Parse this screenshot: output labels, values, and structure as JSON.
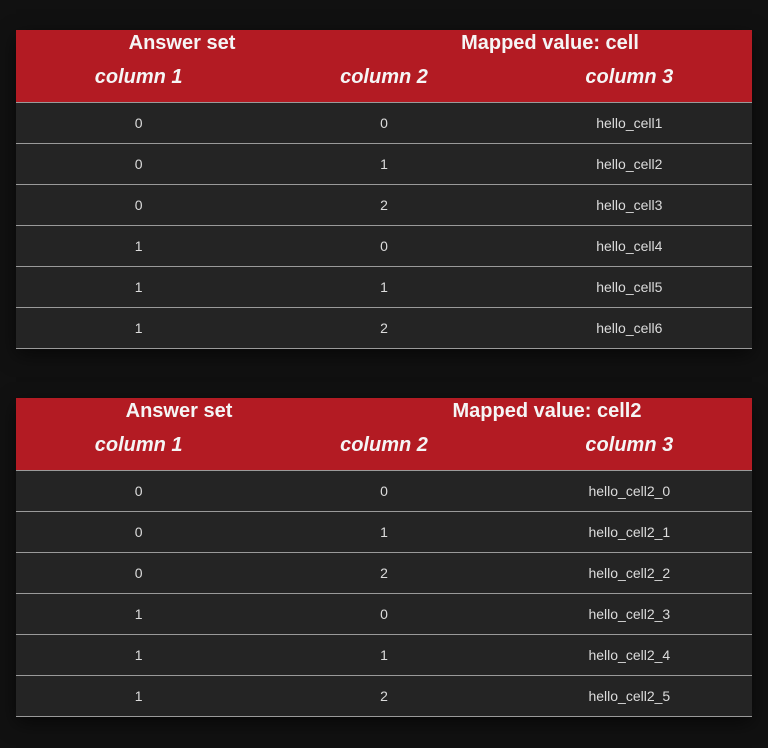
{
  "tables": [
    {
      "group_left": "Answer set",
      "group_right": "Mapped value: cell",
      "columns": [
        "column 1",
        "column 2",
        "column 3"
      ],
      "rows": [
        [
          "0",
          "0",
          "hello_cell1"
        ],
        [
          "0",
          "1",
          "hello_cell2"
        ],
        [
          "0",
          "2",
          "hello_cell3"
        ],
        [
          "1",
          "0",
          "hello_cell4"
        ],
        [
          "1",
          "1",
          "hello_cell5"
        ],
        [
          "1",
          "2",
          "hello_cell6"
        ]
      ]
    },
    {
      "group_left": "Answer set",
      "group_right": "Mapped value: cell2",
      "columns": [
        "column 1",
        "column 2",
        "column 3"
      ],
      "rows": [
        [
          "0",
          "0",
          "hello_cell2_0"
        ],
        [
          "0",
          "1",
          "hello_cell2_1"
        ],
        [
          "0",
          "2",
          "hello_cell2_2"
        ],
        [
          "1",
          "0",
          "hello_cell2_3"
        ],
        [
          "1",
          "1",
          "hello_cell2_4"
        ],
        [
          "1",
          "2",
          "hello_cell2_5"
        ]
      ]
    }
  ],
  "colors": {
    "header_bg": "#b31b23",
    "body_bg": "#242424",
    "page_bg": "#111111"
  }
}
